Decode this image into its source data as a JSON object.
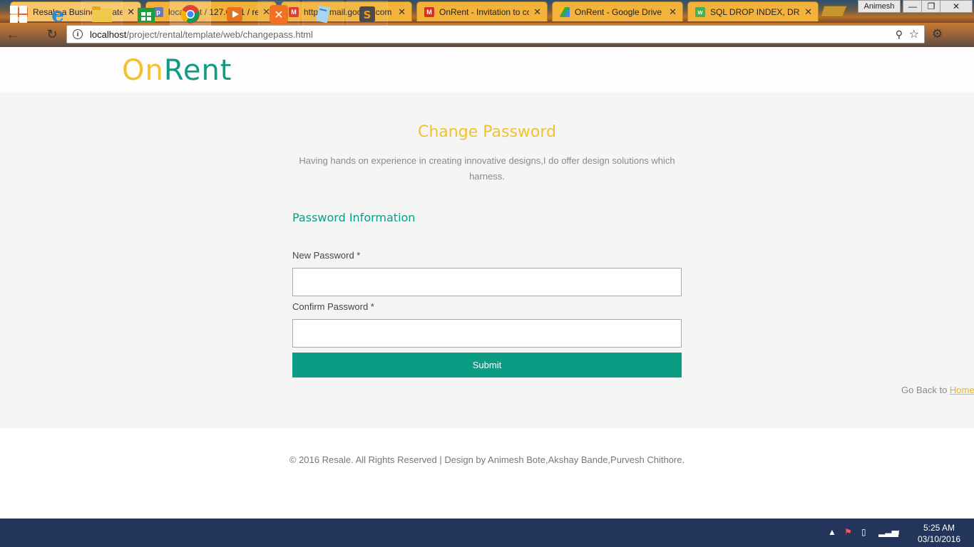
{
  "browser": {
    "tabs": [
      {
        "title": "Resale a Business Catego",
        "icon": "xampp-icon",
        "active": true
      },
      {
        "title": "localhost / 127.0.0.1 / re",
        "icon": "phpmyadmin-icon",
        "active": false
      },
      {
        "title": "https://mail.google.com",
        "icon": "gmail-icon",
        "active": false
      },
      {
        "title": "OnRent - Invitation to co",
        "icon": "gmail-icon",
        "active": false
      },
      {
        "title": "OnRent - Google Drive",
        "icon": "google-drive-icon",
        "active": false
      },
      {
        "title": "SQL DROP INDEX, DROP",
        "icon": "w3schools-icon",
        "active": false
      }
    ],
    "user": "Animesh",
    "url_host": "localhost",
    "url_path": "/project/rental/template/web/changepass.html"
  },
  "site": {
    "logo_part1": "On",
    "logo_part2": "Rent",
    "accent": "#f2c12e",
    "brand": "#0f9c84"
  },
  "form": {
    "heading": "Change Password",
    "subtitle": "Having hands on experience in creating innovative designs,I do offer design solutions which harness.",
    "section_title": "Password Information",
    "new_password_label": "New Password *",
    "confirm_password_label": "Confirm Password *",
    "submit_label": "Submit",
    "go_back_text": "Go Back to ",
    "home_link": "Home"
  },
  "footer": {
    "text": "© 2016 Resale. All Rights Reserved | Design by Animesh Bote,Akshay Bande,Purvesh Chithore."
  },
  "taskbar": {
    "time": "5:25 AM",
    "date": "03/10/2016"
  }
}
